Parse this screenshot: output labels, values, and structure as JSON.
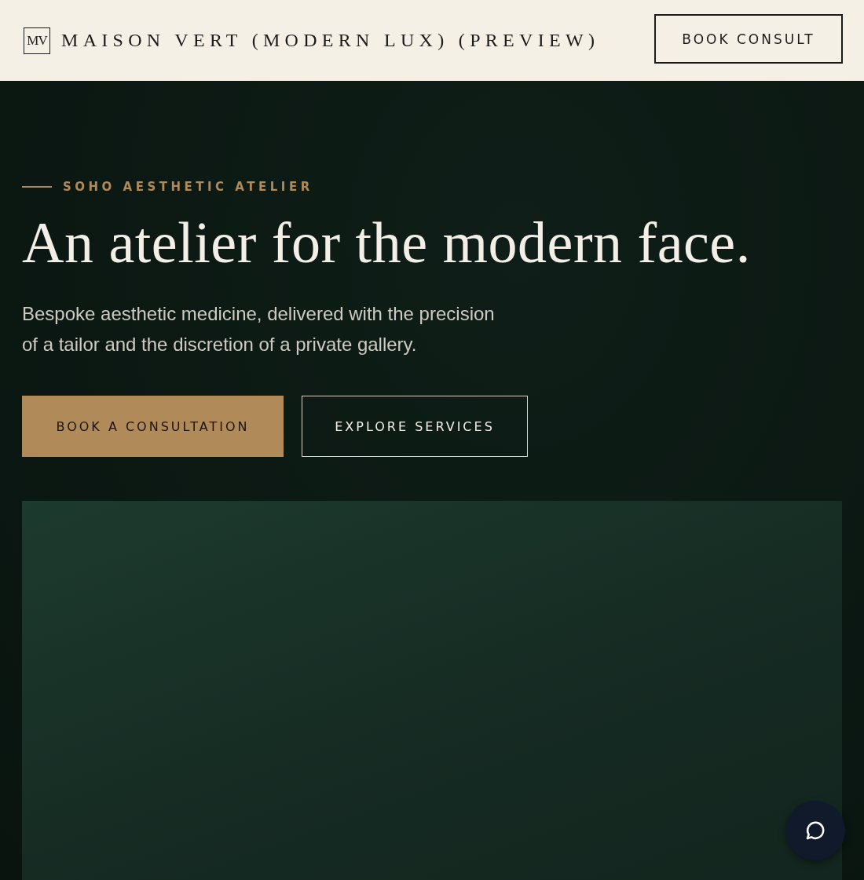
{
  "header": {
    "logo_mark": "MV",
    "brand": "MAISON VERT (MODERN LUX) (PREVIEW)",
    "cta": "BOOK CONSULT"
  },
  "hero": {
    "eyebrow": "SOHO AESTHETIC ATELIER",
    "headline": "An atelier for the modern face.",
    "description": "Bespoke aesthetic medicine, delivered with the precision of a tailor and the discretion of a private gallery.",
    "buttons": [
      {
        "kind": "primary",
        "label": "BOOK A CONSULTATION"
      },
      {
        "kind": "secondary",
        "label": "EXPLORE SERVICES"
      }
    ]
  }
}
